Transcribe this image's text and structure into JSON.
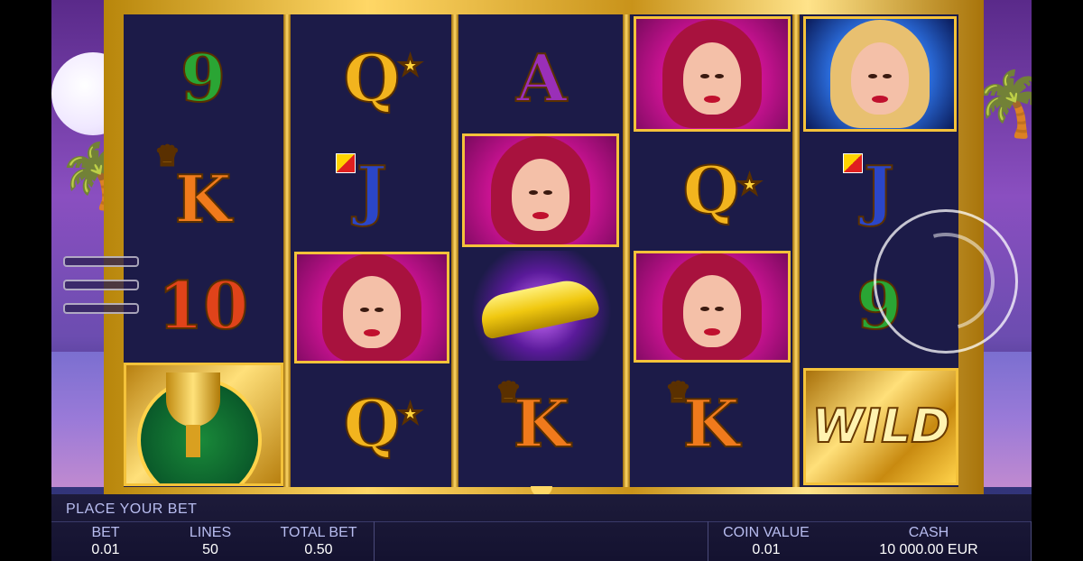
{
  "game": {
    "reels": [
      [
        "9",
        "K",
        "10",
        "trophy-icon"
      ],
      [
        "Q",
        "J",
        "woman-portrait",
        "Q"
      ],
      [
        "A",
        "woman-portrait",
        "car-icon",
        "K"
      ],
      [
        "woman-portrait",
        "Q",
        "woman-portrait",
        "K"
      ],
      [
        "woman-portrait-blonde",
        "J",
        "9",
        "WILD"
      ]
    ],
    "wild_label": "WILD",
    "accent_color": "#f4c23a",
    "reel_bg_color": "#1c1b48"
  },
  "bottom_bar": {
    "status": "PLACE YOUR BET",
    "bet_label": "BET",
    "bet_value": "0.01",
    "lines_label": "LINES",
    "lines_value": "50",
    "total_bet_label": "TOTAL BET",
    "total_bet_value": "0.50",
    "coin_value_label": "COIN VALUE",
    "coin_value_value": "0.01",
    "cash_label": "CASH",
    "cash_value": "10 000.00 EUR"
  }
}
